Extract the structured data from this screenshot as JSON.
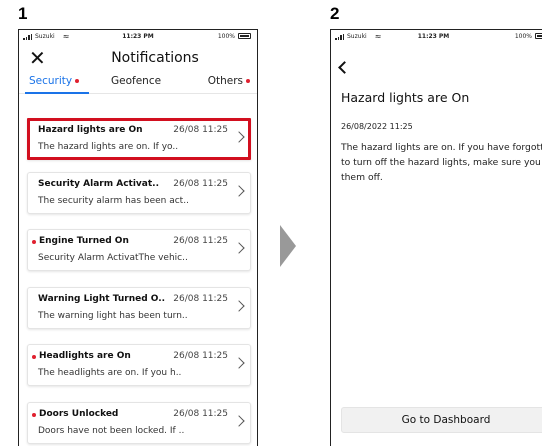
{
  "steps": {
    "first": "1",
    "second": "2"
  },
  "status_bar": {
    "carrier": "Suzuki",
    "time": "11:23 PM",
    "battery": "100%"
  },
  "screen1": {
    "title": "Notifications",
    "tabs": [
      {
        "label": "Security",
        "unread": true,
        "active": true
      },
      {
        "label": "Geofence",
        "unread": false,
        "active": false
      },
      {
        "label": "Others",
        "unread": true,
        "active": false
      }
    ],
    "notifications": [
      {
        "title": "Hazard lights are On",
        "time": "26/08 11:25",
        "preview": "The hazard lights are on. If yo..",
        "unread": false,
        "highlighted": true
      },
      {
        "title": "Security Alarm Activat..",
        "time": "26/08 11:25",
        "preview": "The security alarm has been act..",
        "unread": false,
        "highlighted": false
      },
      {
        "title": "Engine Turned On",
        "time": "26/08 11:25",
        "preview": "Security Alarm ActivatThe vehic..",
        "unread": true,
        "highlighted": false
      },
      {
        "title": "Warning Light Turned O..",
        "time": "26/08 11:25",
        "preview": "The warning light has been turn..",
        "unread": false,
        "highlighted": false
      },
      {
        "title": "Headlights are On",
        "time": "26/08 11:25",
        "preview": "The headlights are on. If you h..",
        "unread": true,
        "highlighted": false
      },
      {
        "title": "Doors Unlocked",
        "time": "26/08 11:25",
        "preview": "Doors have not been locked. If ..",
        "unread": true,
        "highlighted": false
      }
    ]
  },
  "screen2": {
    "title": "Hazard lights are On",
    "date": "26/08/2022 11:25",
    "body": "The hazard lights are on. If you have forgotten to turn off the hazard lights, make sure you turn them off.",
    "button_label": "Go to Dashboard"
  },
  "colors": {
    "accent": "#1a73e8",
    "unread_dot": "#e0202f",
    "highlight": "#d20f1f"
  }
}
